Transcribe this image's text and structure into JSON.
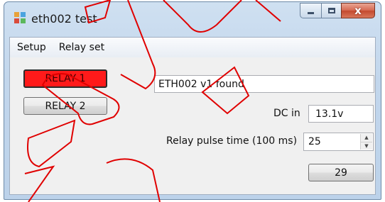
{
  "window": {
    "title": "eth002 test",
    "icon": "app-window-icon",
    "caption": {
      "minimize_icon": "minimize-icon",
      "maximize_icon": "maximize-icon",
      "close_icon": "close-icon",
      "close_glyph": "x"
    }
  },
  "menu": {
    "items": [
      {
        "label": "Setup"
      },
      {
        "label": "Relay set"
      }
    ]
  },
  "relays": {
    "relay1_label": "RELAY 1",
    "relay1_color": "#ff1a1a",
    "relay2_label": "RELAY 2"
  },
  "status": {
    "value": "ETH002 v1 found"
  },
  "dc_in": {
    "label": "DC in",
    "value": "13.1v"
  },
  "pulse": {
    "label": "Relay pulse time (100 ms)",
    "value": "25",
    "up_glyph": "▲",
    "down_glyph": "▼"
  },
  "counter": {
    "label": "29"
  }
}
